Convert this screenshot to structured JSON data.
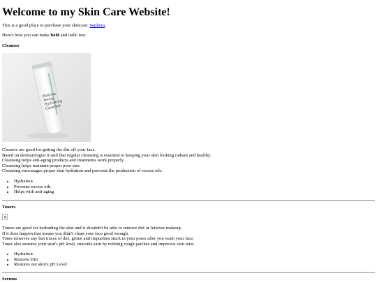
{
  "title": "Welcome to my Skin Care Website!",
  "intro": {
    "text_before_link": "This is a good place to purchase your skincare: ",
    "link_text": "Sephora",
    "text_after_link": "."
  },
  "format_line": {
    "before": "Here's how you can make ",
    "bold": "bold",
    "after": " and italic text."
  },
  "cleanser": {
    "heading": "Cleanser",
    "image_text": [
      "Matcha",
      "Hemp",
      "Hydrating",
      "Cleanser"
    ],
    "paragraph_lines": [
      "Cleasers are good for getting the dirt off your face.",
      "Based on dermatologist it said that regular cleansing is essential to keeping your skin looking radiant and healthy.",
      "Cleansing helps anti-aging products and treatments work properly.",
      "Cleansing helps maintain proper pore size.",
      "Cleansing encourages proper skin hydration and prevents the production of excess oils."
    ],
    "bullets": [
      "Hydration",
      "Prevents excess oils",
      "Helps with anti-aging"
    ]
  },
  "toners": {
    "heading": "Toners",
    "paragraph_lines": [
      "Toners are good for hydrading the skin and it shouldn't be able to remove dirt or leftover makeup.",
      "If it does happen that means you didn't clean your face good enough.",
      "Toner removes any last traces of dirt, grime and impurities stuck in your pores after you wash your face.",
      "Toner also restores your skin's pH level, smooths skin by refining rough patches and improves skin tone."
    ],
    "bullets": [
      "Hydration",
      "Remove Dirt",
      "Restores our skin's pH Level"
    ]
  },
  "serums": {
    "heading": "Serums"
  }
}
